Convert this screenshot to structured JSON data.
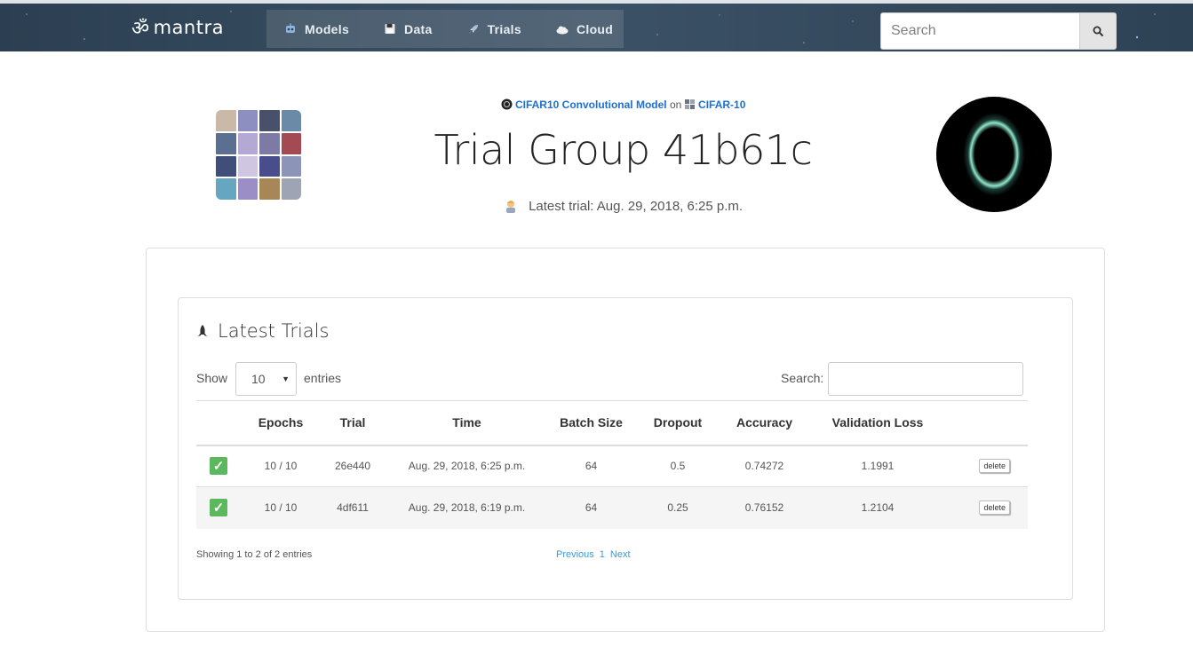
{
  "navbar": {
    "brand_symbol": "ॐ",
    "brand_name": "mantra",
    "items": [
      {
        "label": "Models",
        "icon": "robot-icon"
      },
      {
        "label": "Data",
        "icon": "floppy-disk-icon"
      },
      {
        "label": "Trials",
        "icon": "rocket-icon"
      },
      {
        "label": "Cloud",
        "icon": "cloud-icon"
      }
    ],
    "search_placeholder": "Search"
  },
  "header": {
    "model_name": "CIFAR10 Convolutional Model",
    "on_text": "on",
    "dataset_name": "CIFAR-10",
    "title": "Trial Group 41b61c",
    "latest_trial": "Latest trial: Aug. 29, 2018, 6:25 p.m."
  },
  "trials_card": {
    "title": "Latest Trials",
    "show_label": "Show",
    "entries_value": "10",
    "entries_label": "entries",
    "search_label": "Search:",
    "columns": [
      "",
      "Epochs",
      "Trial",
      "Time",
      "Batch Size",
      "Dropout",
      "Accuracy",
      "Validation Loss",
      ""
    ],
    "rows": [
      {
        "status": "complete",
        "epochs": "10 / 10",
        "trial": "26e440",
        "time": "Aug. 29, 2018, 6:25 p.m.",
        "batch_size": "64",
        "dropout": "0.5",
        "accuracy": "0.74272",
        "val_loss": "1.1991",
        "action": "delete"
      },
      {
        "status": "complete",
        "epochs": "10 / 10",
        "trial": "4df611",
        "time": "Aug. 29, 2018, 6:19 p.m.",
        "batch_size": "64",
        "dropout": "0.25",
        "accuracy": "0.76152",
        "val_loss": "1.2104",
        "action": "delete"
      }
    ],
    "info": "Showing 1 to 2 of 2 entries",
    "pagination": {
      "previous": "Previous",
      "page": "1",
      "next": "Next"
    }
  },
  "colors": {
    "accent": "#1e6fd0",
    "success": "#5cb85c",
    "link": "#3b9ad9"
  }
}
